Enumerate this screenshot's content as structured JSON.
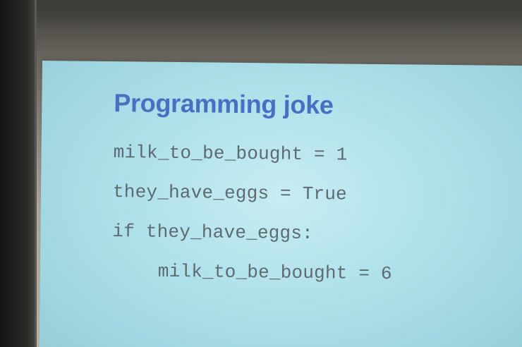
{
  "slide": {
    "title": "Programming joke",
    "code_lines": [
      "milk_to_be_bought = 1",
      "they_have_eggs = True",
      "if they_have_eggs:",
      "milk_to_be_bought = 6"
    ]
  },
  "colors": {
    "title": "#4a6fc2",
    "code_text": "#5d6a70",
    "slide_background": "#afe1ea"
  }
}
